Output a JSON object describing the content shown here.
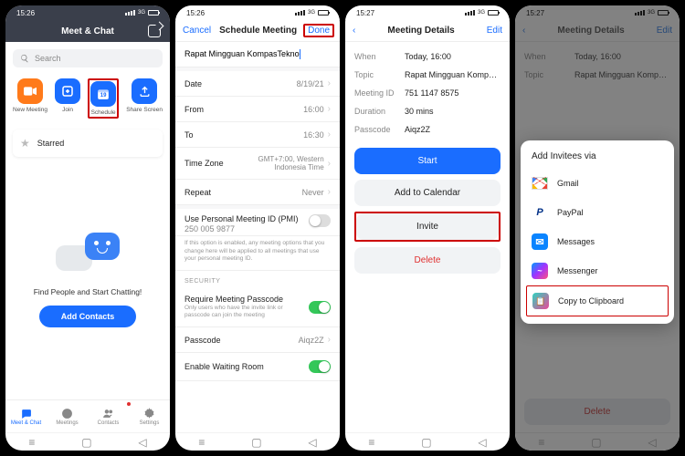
{
  "status": {
    "time": "15:26",
    "time2": "15:27"
  },
  "s1": {
    "title": "Meet & Chat",
    "search_ph": "Search",
    "actions": {
      "new": "New Meeting",
      "join": "Join",
      "schedule": "Schedule",
      "share": "Share Screen",
      "cal_day": "19"
    },
    "starred": "Starred",
    "empty": "Find People and Start Chatting!",
    "add": "Add Contacts",
    "tabs": {
      "chat": "Meet & Chat",
      "meet": "Meetings",
      "cont": "Contacts",
      "set": "Settings"
    }
  },
  "s2": {
    "cancel": "Cancel",
    "title": "Schedule Meeting",
    "done": "Done",
    "topic": "Rapat Mingguan KompasTekno",
    "rows": {
      "date_l": "Date",
      "date_v": "8/19/21",
      "from_l": "From",
      "from_v": "16:00",
      "to_l": "To",
      "to_v": "16:30",
      "tz_l": "Time Zone",
      "tz_v": "GMT+7:00, Western Indonesia Time",
      "rep_l": "Repeat",
      "rep_v": "Never",
      "pmi_l": "Use Personal Meeting ID (PMI)",
      "pmi_v": "250 005 9877",
      "pmi_note": "If this option is enabled, any meeting options that you change here will be applied to all meetings that use your personal meeting ID.",
      "sec": "SECURITY",
      "pass_req_l": "Require Meeting Passcode",
      "pass_req_sub": "Only users who have the invite link or passcode can join the meeting",
      "pass_l": "Passcode",
      "pass_v": "Aiqz2Z",
      "wait_l": "Enable Waiting Room"
    }
  },
  "s3": {
    "title": "Meeting Details",
    "edit": "Edit",
    "when_l": "When",
    "when_v": "Today, 16:00",
    "topic_l": "Topic",
    "topic_v": "Rapat Mingguan KompasTek...",
    "id_l": "Meeting ID",
    "id_v": "751 1147 8575",
    "dur_l": "Duration",
    "dur_v": "30 mins",
    "pass_l": "Passcode",
    "pass_v": "Aiqz2Z",
    "start": "Start",
    "cal": "Add to Calendar",
    "inv": "Invite",
    "del": "Delete"
  },
  "s4": {
    "title": "Meeting Details",
    "edit": "Edit",
    "sheet_title": "Add Invitees via",
    "opts": {
      "gmail": "Gmail",
      "paypal": "PayPal",
      "msgs": "Messages",
      "fbm": "Messenger",
      "clip": "Copy to Clipboard"
    },
    "del": "Delete",
    "when_l": "When",
    "when_v": "Today, 16:00",
    "topic_l": "Topic",
    "topic_v": "Rapat Mingguan KompasTek..."
  }
}
